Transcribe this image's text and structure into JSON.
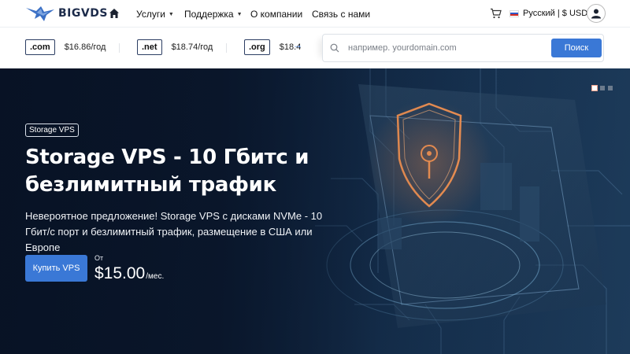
{
  "nav": {
    "logo_text": "BIGVDS",
    "menu": [
      {
        "label": "Услуги",
        "has_caret": true
      },
      {
        "label": "Поддержка",
        "has_caret": true
      },
      {
        "label": "О компании",
        "has_caret": false
      },
      {
        "label": "Связь с нами",
        "has_caret": false
      }
    ],
    "language_currency": "Русский | $ USD",
    "icons": {
      "home": "home-icon",
      "cart": "cart-icon",
      "user": "user-icon",
      "flag": "russia-flag-icon"
    }
  },
  "domains": {
    "tlds": [
      {
        "name": ".com",
        "price": "$16.86/год"
      },
      {
        "name": ".net",
        "price": "$18.74/год"
      },
      {
        "name": ".org",
        "price": "$18.4"
      }
    ],
    "search_placeholder": "например. yourdomain.com",
    "search_button": "Поиск"
  },
  "hero": {
    "badge": "Storage VPS",
    "title": "Storage VPS - 10 Гбитс и безлимитный трафик",
    "description": "Невероятное предложение! Storage VPS с дисками NVMe - 10 Гбит/с порт и безлимитный трафик, размещение в США или Европе",
    "buy_button": "Купить VPS",
    "price_from": "От",
    "price_amount": "$15.00",
    "price_unit": "/мес.",
    "slides_total": 3,
    "slide_active": 1
  },
  "colors": {
    "accent": "#3a78d6",
    "hero_bg": "#0f2440",
    "shield_glow": "#f08a4b",
    "logo": "#1c2b4a"
  }
}
